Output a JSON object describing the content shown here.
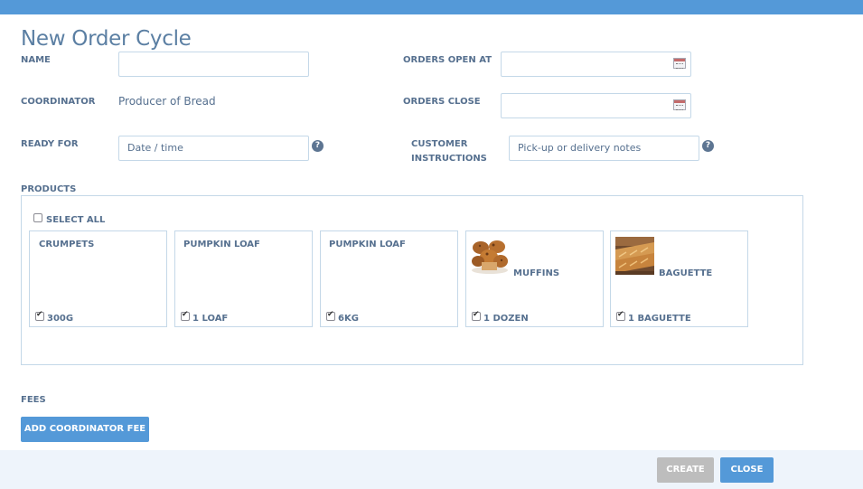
{
  "dialog": {
    "title": "New Order Cycle"
  },
  "form": {
    "name": {
      "label": "NAME",
      "value": ""
    },
    "orders_open_at": {
      "label": "ORDERS OPEN AT",
      "value": "",
      "icon": "calendar-icon"
    },
    "coordinator": {
      "label": "COORDINATOR",
      "value": "Producer of Bread"
    },
    "orders_close": {
      "label": "ORDERS CLOSE",
      "value": "",
      "icon": "calendar-icon"
    },
    "ready_for": {
      "label": "READY FOR",
      "placeholder": "Date / time",
      "help": "?"
    },
    "customer_instructions": {
      "label_line1": "CUSTOMER",
      "label_line2": "INSTRUCTIONS",
      "placeholder": "Pick-up or delivery notes",
      "help": "?"
    }
  },
  "products": {
    "label": "PRODUCTS",
    "select_all": {
      "label": "SELECT ALL",
      "checked": false
    },
    "items": [
      {
        "name": "CRUMPETS",
        "variant": "300G",
        "checked": true,
        "image": null
      },
      {
        "name": "PUMPKIN LOAF",
        "variant": "1 LOAF",
        "checked": true,
        "image": null
      },
      {
        "name": "PUMPKIN LOAF",
        "variant": "6KG",
        "checked": true,
        "image": null
      },
      {
        "name": "MUFFINS",
        "variant": "1 DOZEN",
        "checked": true,
        "image": "muffins-photo"
      },
      {
        "name": "BAGUETTE",
        "variant": "1 BAGUETTE",
        "checked": true,
        "image": "baguette-photo"
      }
    ]
  },
  "fees": {
    "label": "FEES",
    "add_button": "ADD COORDINATOR FEE"
  },
  "footer": {
    "create_label": "CREATE",
    "close_label": "CLOSE"
  },
  "colors": {
    "accent": "#5499d8",
    "text": "#56708f",
    "border": "#c4d8e8",
    "disabled": "#bdbdbd",
    "footer_bg": "#eef4fb"
  }
}
